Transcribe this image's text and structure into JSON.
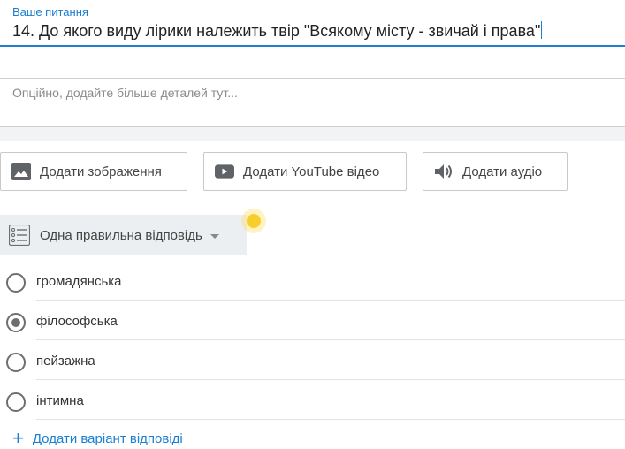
{
  "question": {
    "label": "Ваше питання",
    "value": "14.  До якого виду лірики належить твір \"Всякому місту - звичай і права\""
  },
  "details": {
    "placeholder": "Опційно, додайте більше деталей тут..."
  },
  "media_buttons": {
    "add_image": "Додати зображення",
    "add_youtube": "Додати YouTube відео",
    "add_audio": "Додати аудіо"
  },
  "answer_type": {
    "selected": "Одна правильна відповідь"
  },
  "options": [
    {
      "label": "громадянська",
      "checked": false
    },
    {
      "label": "філософська",
      "checked": true
    },
    {
      "label": "пейзажна",
      "checked": false
    },
    {
      "label": "інтимна",
      "checked": false
    }
  ],
  "add_answer": {
    "label": "Додати варіант відповіді"
  },
  "colors": {
    "accent": "#1f7fd4",
    "cursor_highlight": "#f8cf2a"
  }
}
